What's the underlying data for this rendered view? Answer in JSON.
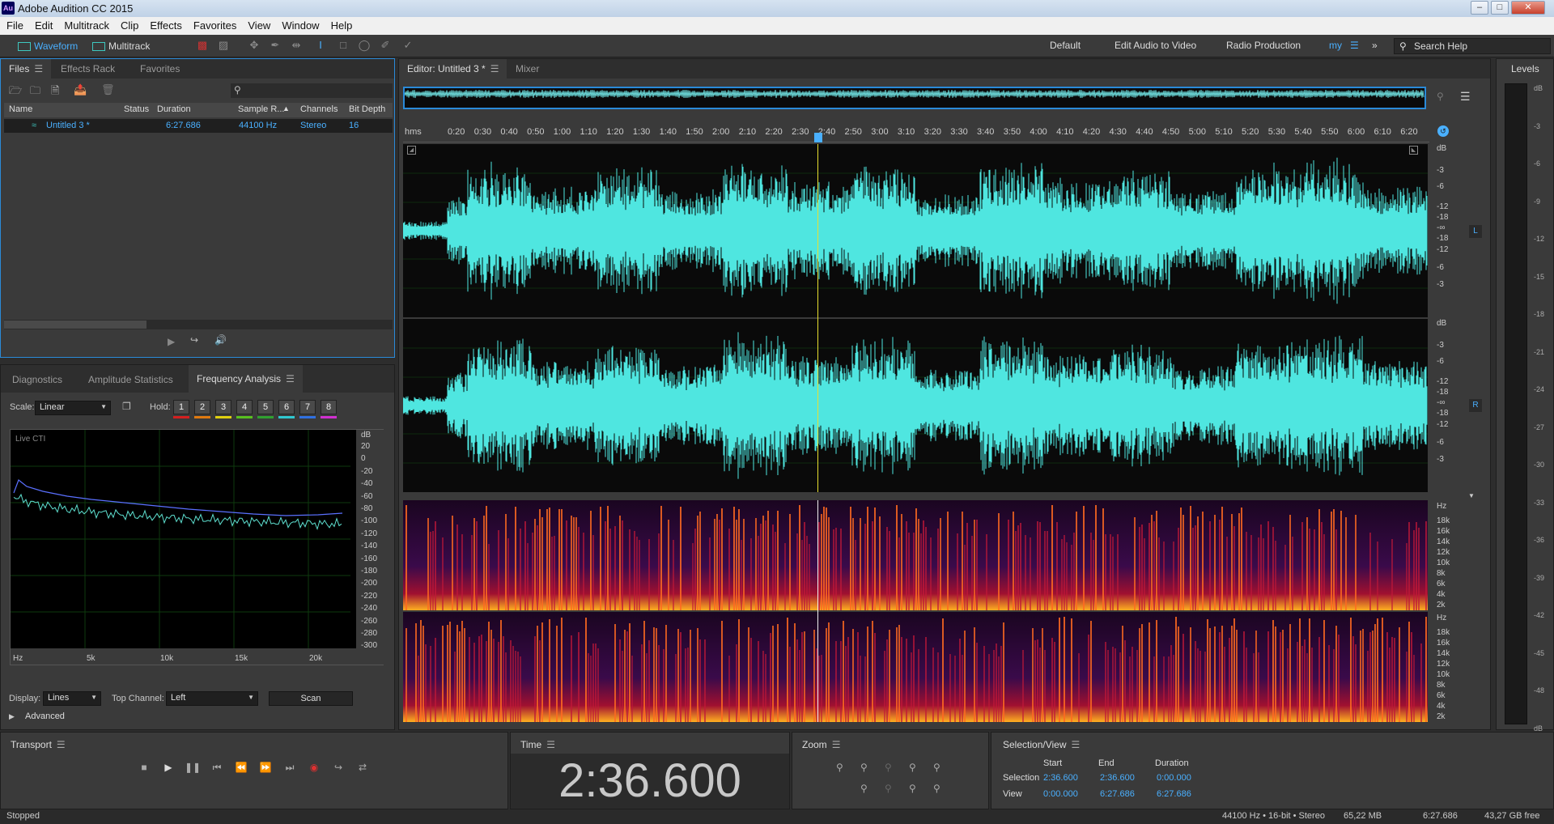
{
  "window": {
    "title": "Adobe Audition CC 2015",
    "logo": "Au"
  },
  "menu": [
    "File",
    "Edit",
    "Multitrack",
    "Clip",
    "Effects",
    "Favorites",
    "View",
    "Window",
    "Help"
  ],
  "toolbar": {
    "waveform_label": "Waveform",
    "multitrack_label": "Multitrack",
    "workspaces": [
      "Default",
      "Edit Audio to Video",
      "Radio Production",
      "my"
    ],
    "search_placeholder": "Search Help"
  },
  "files_panel": {
    "tabs": [
      "Files",
      "Effects Rack",
      "Favorites"
    ],
    "columns": [
      "Name",
      "Status",
      "Duration",
      "Sample R...",
      "Channels",
      "Bit Depth"
    ],
    "rows": [
      {
        "name": "Untitled 3 *",
        "status": "",
        "duration": "6:27.686",
        "sample_rate": "44100 Hz",
        "channels": "Stereo",
        "bit_depth": "16"
      }
    ]
  },
  "analysis_panel": {
    "tabs": [
      "Diagnostics",
      "Amplitude Statistics",
      "Frequency Analysis"
    ],
    "scale_label": "Scale:",
    "scale_value": "Linear",
    "hold_label": "Hold:",
    "hold_buttons": [
      "1",
      "2",
      "3",
      "4",
      "5",
      "6",
      "7",
      "8"
    ],
    "hold_colors": [
      "#d42020",
      "#e07a10",
      "#e0d010",
      "#58c020",
      "#30a030",
      "#30c8d0",
      "#3070e0",
      "#d030d0"
    ],
    "graph_label": "Live CTI",
    "db_unit": "dB",
    "db_ticks": [
      "20",
      "0",
      "-20",
      "-40",
      "-60",
      "-80",
      "-100",
      "-120",
      "-140",
      "-160",
      "-180",
      "-200",
      "-220",
      "-240",
      "-260",
      "-280",
      "-300"
    ],
    "hz_ticks": [
      "Hz",
      "5k",
      "10k",
      "15k",
      "20k"
    ],
    "display_label": "Display:",
    "display_value": "Lines",
    "top_channel_label": "Top Channel:",
    "top_channel_value": "Left",
    "scan_label": "Scan",
    "advanced_label": "Advanced"
  },
  "editor": {
    "tabs": [
      "Editor: Untitled 3 *",
      "Mixer"
    ],
    "ruler_unit": "hms",
    "ruler_ticks": [
      "0:20",
      "0:30",
      "0:40",
      "0:50",
      "1:00",
      "1:10",
      "1:20",
      "1:30",
      "1:40",
      "1:50",
      "2:00",
      "2:10",
      "2:20",
      "2:30",
      "2:40",
      "2:50",
      "3:00",
      "3:10",
      "3:20",
      "3:30",
      "3:40",
      "3:50",
      "4:00",
      "4:10",
      "4:20",
      "4:30",
      "4:40",
      "4:50",
      "5:00",
      "5:10",
      "5:20",
      "5:30",
      "5:40",
      "5:50",
      "6:00",
      "6:10",
      "6:20"
    ],
    "db_scale": [
      "dB",
      "-3",
      "-6",
      "-12",
      "-18",
      "-∞",
      "-18",
      "-12",
      "-6",
      "-3"
    ],
    "channel_labels": [
      "L",
      "R"
    ],
    "hz_scale": [
      "Hz",
      "18k",
      "16k",
      "14k",
      "12k",
      "10k",
      "8k",
      "6k",
      "4k",
      "2k"
    ],
    "wave_color": "#4fe6e0"
  },
  "levels": {
    "title": "Levels",
    "ticks": [
      "dB",
      "-3",
      "-6",
      "-9",
      "-12",
      "-15",
      "-18",
      "-21",
      "-24",
      "-27",
      "-30",
      "-33",
      "-36",
      "-39",
      "-42",
      "-45",
      "-48",
      "dB"
    ]
  },
  "transport": {
    "title": "Transport"
  },
  "time": {
    "title": "Time",
    "value": "2:36.600"
  },
  "zoom": {
    "title": "Zoom"
  },
  "selection_view": {
    "title": "Selection/View",
    "headers": [
      "Start",
      "End",
      "Duration"
    ],
    "rows": [
      {
        "label": "Selection",
        "start": "2:36.600",
        "end": "2:36.600",
        "duration": "0:00.000"
      },
      {
        "label": "View",
        "start": "0:00.000",
        "end": "6:27.686",
        "duration": "6:27.686"
      }
    ]
  },
  "status": {
    "state": "Stopped",
    "format": "44100 Hz • 16-bit • Stereo",
    "size": "65,22 MB",
    "duration": "6:27.686",
    "free": "43,27 GB free"
  }
}
